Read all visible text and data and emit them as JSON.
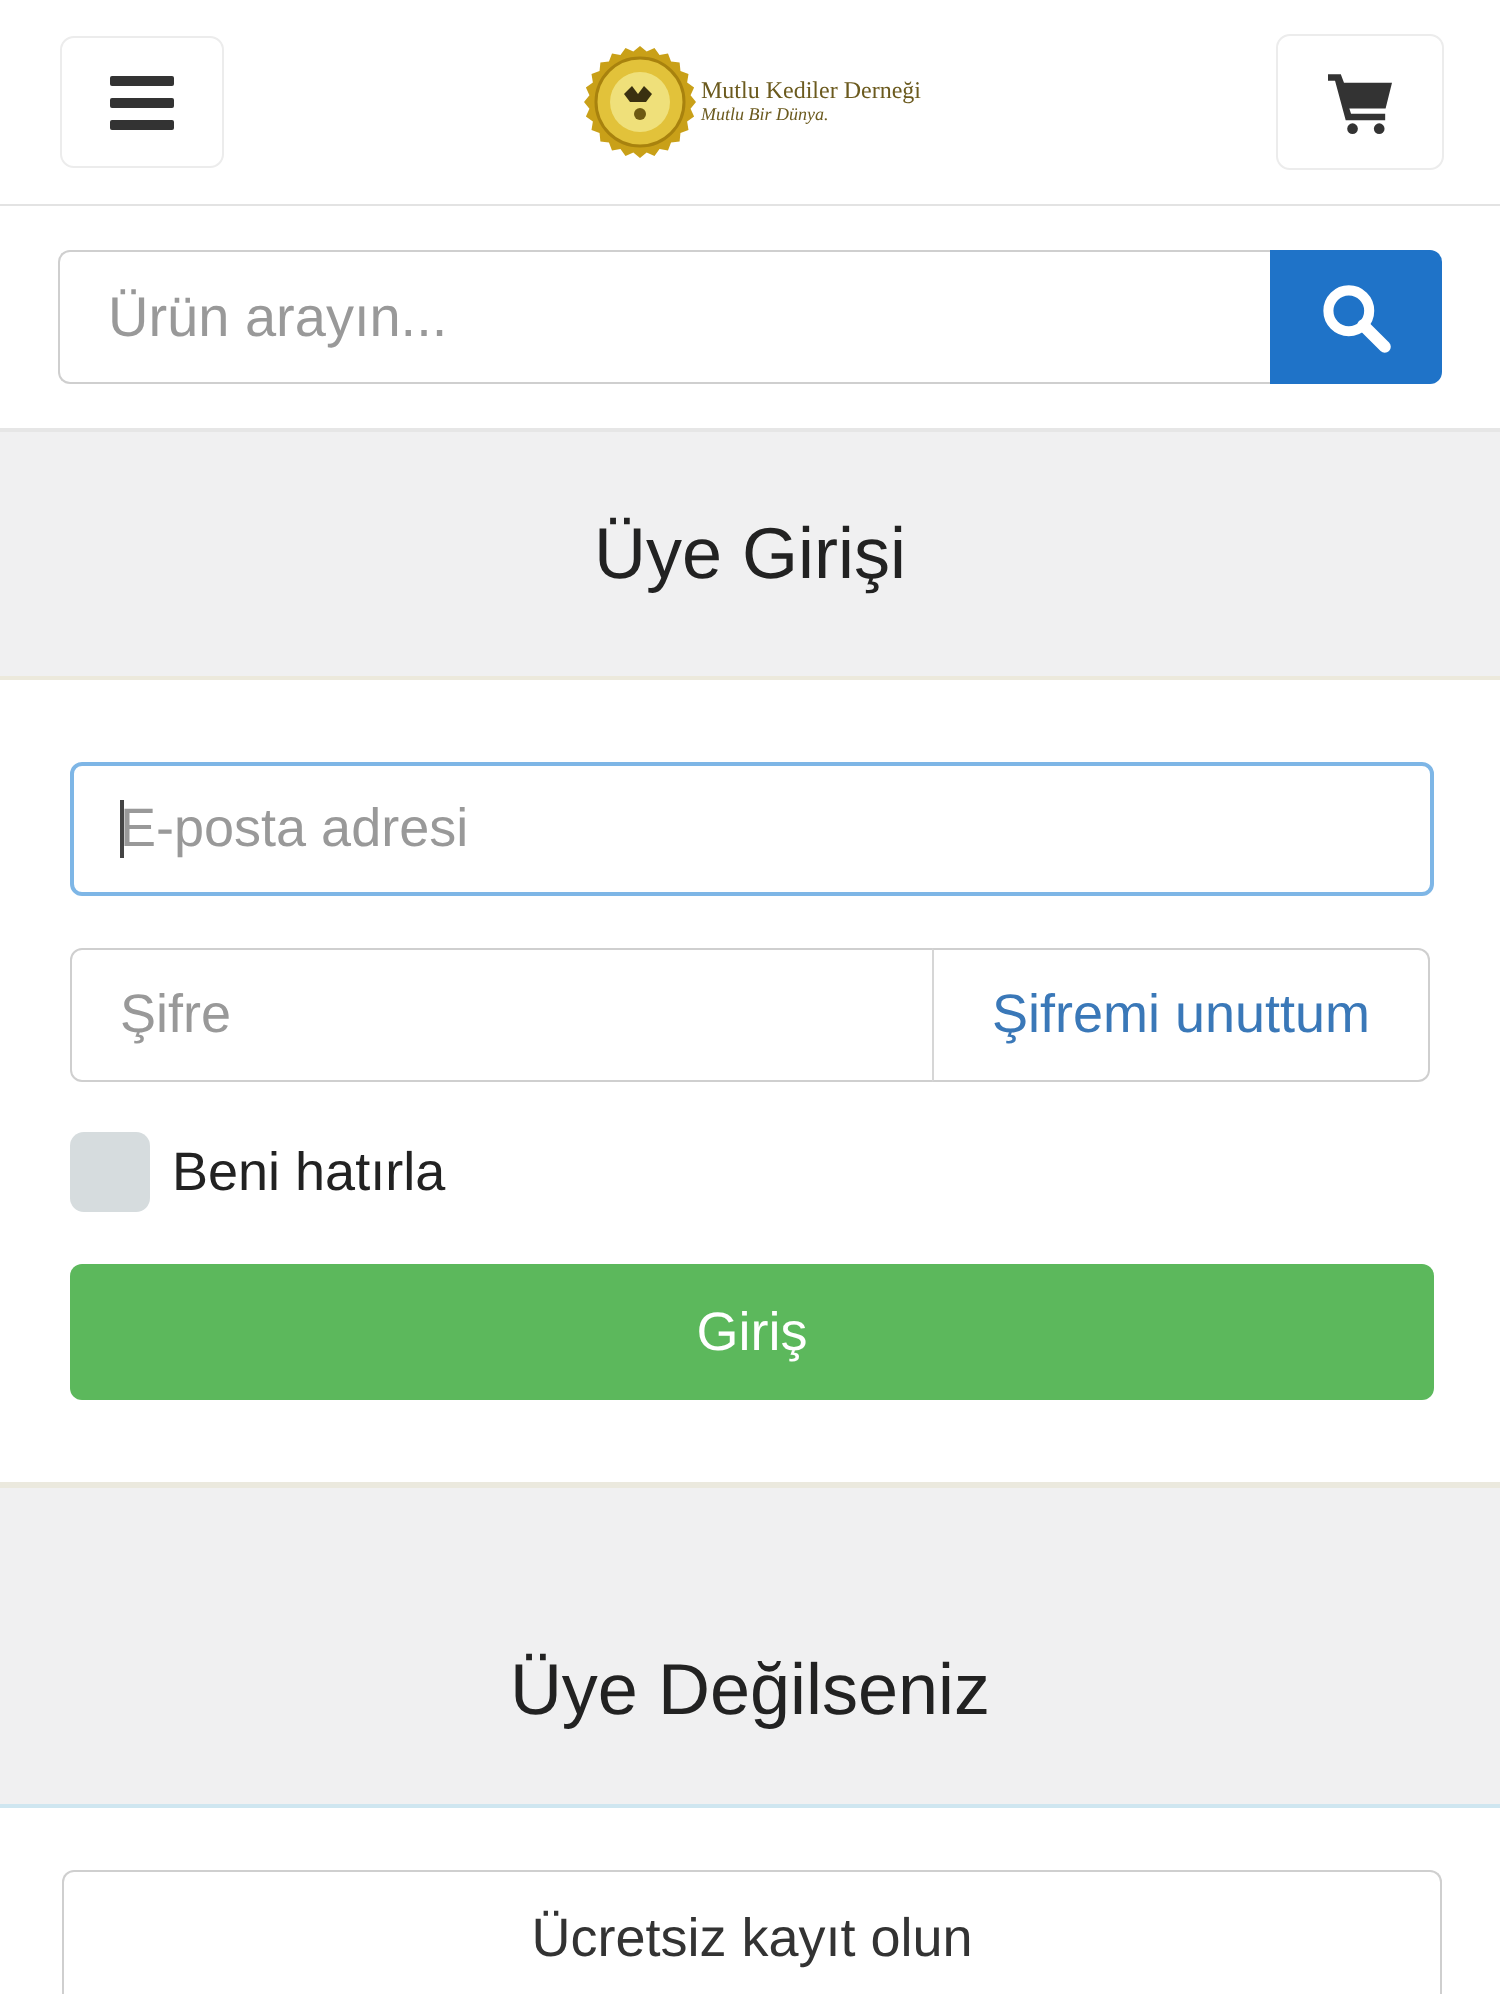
{
  "header": {
    "logo": {
      "title": "Mutlu Kediler Derneği",
      "tagline": "Mutlu Bir Dünya."
    }
  },
  "search": {
    "placeholder": "Ürün arayın..."
  },
  "login": {
    "title": "Üye Girişi",
    "email": {
      "placeholder": "E-posta adresi",
      "focused": true
    },
    "password": {
      "placeholder": "Şifre"
    },
    "forgot_link": "Şifremi unuttum",
    "remember": {
      "label": "Beni hatırla",
      "checked": false
    },
    "submit": "Giriş"
  },
  "register": {
    "title": "Üye Değilseniz",
    "button": "Ücretsiz kayıt olun"
  }
}
